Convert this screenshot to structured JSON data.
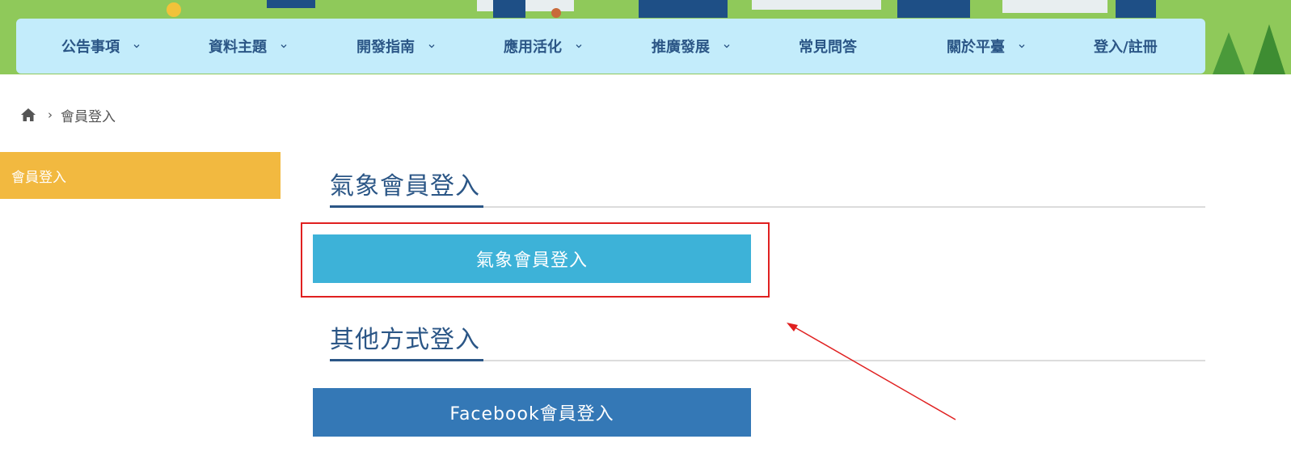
{
  "nav": {
    "items": [
      {
        "label": "公告事項",
        "has_dropdown": true
      },
      {
        "label": "資料主題",
        "has_dropdown": true
      },
      {
        "label": "開發指南",
        "has_dropdown": true
      },
      {
        "label": "應用活化",
        "has_dropdown": true
      },
      {
        "label": "推廣發展",
        "has_dropdown": true
      },
      {
        "label": "常見問答",
        "has_dropdown": false
      },
      {
        "label": "關於平臺",
        "has_dropdown": true
      },
      {
        "label": "登入/註冊",
        "has_dropdown": false
      }
    ]
  },
  "breadcrumb": {
    "home_icon": "home-icon",
    "current": "會員登入"
  },
  "sidebar": {
    "items": [
      {
        "label": "會員登入"
      }
    ]
  },
  "main": {
    "section1_title": "氣象會員登入",
    "cwb_login_button": "氣象會員登入",
    "section2_title": "其他方式登入",
    "facebook_login_button": "Facebook會員登入"
  },
  "colors": {
    "nav_bg": "#c3ecfb",
    "nav_text": "#2b5686",
    "sidebar_active": "#f2b940",
    "cwb_button": "#3db2d8",
    "facebook_button": "#3478b6",
    "annotation": "#e02020"
  }
}
